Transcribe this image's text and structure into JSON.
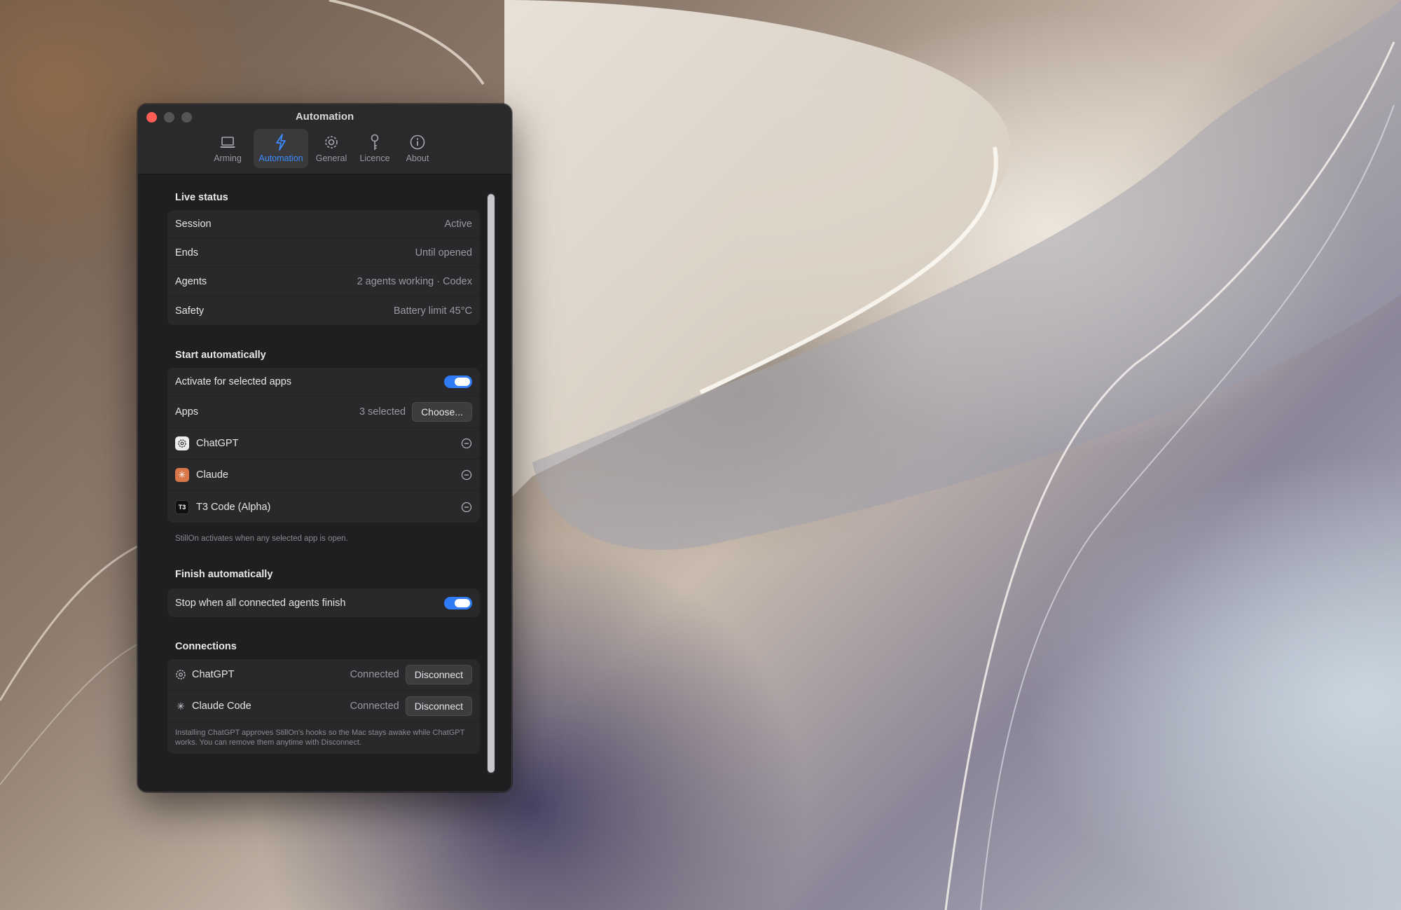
{
  "window": {
    "title": "Automation"
  },
  "tabs": [
    {
      "label": "Arming",
      "icon": "laptop-icon"
    },
    {
      "label": "Automation",
      "icon": "bolt-icon",
      "active": true
    },
    {
      "label": "General",
      "icon": "gear-icon"
    },
    {
      "label": "Licence",
      "icon": "key-icon"
    },
    {
      "label": "About",
      "icon": "info-icon"
    }
  ],
  "live_status": {
    "title": "Live status",
    "rows": [
      {
        "label": "Session",
        "value": "Active"
      },
      {
        "label": "Ends",
        "value": "Until opened"
      },
      {
        "label": "Agents",
        "value": "2 agents working · Codex"
      },
      {
        "label": "Safety",
        "value": "Battery limit 45°C"
      }
    ]
  },
  "start_automatically": {
    "title": "Start automatically",
    "activate_label": "Activate for selected apps",
    "activate_on": true,
    "apps_label": "Apps",
    "apps_count": "3 selected",
    "choose_label": "Choose...",
    "apps": [
      {
        "name": "ChatGPT",
        "icon": "chatgpt-icon"
      },
      {
        "name": "Claude",
        "icon": "claude-icon",
        "glyph": "✳"
      },
      {
        "name": "T3 Code (Alpha)",
        "icon": "t3-icon",
        "glyph": "T3"
      }
    ],
    "note": "StillOn activates when any selected app is open."
  },
  "finish_automatically": {
    "title": "Finish automatically",
    "stop_label": "Stop when all connected agents finish",
    "stop_on": true
  },
  "connections": {
    "title": "Connections",
    "items": [
      {
        "name": "ChatGPT",
        "status": "Connected",
        "action": "Disconnect",
        "icon": "chatgpt-icon"
      },
      {
        "name": "Claude Code",
        "status": "Connected",
        "action": "Disconnect",
        "icon": "claude-icon",
        "glyph": "✳"
      }
    ],
    "note": "Installing ChatGPT approves StillOn's hooks so the Mac stays awake while ChatGPT works. You can remove them anytime with Disconnect."
  },
  "colors": {
    "accent": "#2f7cf6",
    "active_tab_text": "#3d8bff",
    "close": "#ff5f57",
    "window_bg": "#1f1f21"
  }
}
